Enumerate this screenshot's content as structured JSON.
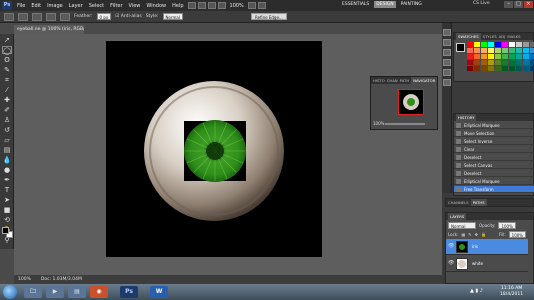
{
  "app": {
    "logo": "Ps",
    "menu": [
      "File",
      "Edit",
      "Image",
      "Layer",
      "Select",
      "Filter",
      "View",
      "Window",
      "Help"
    ],
    "zoom_display": "100%",
    "workspaces": [
      "ESSENTIALS",
      "DESIGN",
      "PAINTING"
    ],
    "active_workspace": "DESIGN",
    "cs_live": "CS Live"
  },
  "options_bar": {
    "feather_label": "Feather:",
    "feather_value": "0 px",
    "antialias_label": "Anti-alias",
    "style_label": "Style:",
    "style_value": "Normal",
    "refine_edge_label": "Refine Edge..."
  },
  "document": {
    "tab_title": "eyeball.ne @ 100% (iris, RGB/8)",
    "status_zoom": "100%",
    "status_doc": "Doc: 1.03M/3.04M"
  },
  "swatches_panel": {
    "tabs": [
      "SWATCHES",
      "STYLES",
      "ADJ",
      "MASKS"
    ],
    "colors": [
      "#ff0000",
      "#ffff00",
      "#00ff00",
      "#00ffff",
      "#0000ff",
      "#ff00ff",
      "#ffffff",
      "#cccccc",
      "#999999",
      "#666666",
      "#000000",
      "#f26c4f",
      "#f68e55",
      "#fbaf5c",
      "#fff467",
      "#acd372",
      "#7cc576",
      "#3bb878",
      "#1abbb4",
      "#00bff3",
      "#438ccb",
      "#5574b9",
      "#ed1c24",
      "#f26522",
      "#f7941d",
      "#fff200",
      "#8dc73f",
      "#39b54a",
      "#00a651",
      "#00a99d",
      "#00aeef",
      "#0072bc",
      "#0054a6",
      "#9e0b0f",
      "#a0410d",
      "#a36209",
      "#aba000",
      "#598527",
      "#1a7b30",
      "#007236",
      "#00746b",
      "#0076a3",
      "#004b80",
      "#003471",
      "#790000",
      "#7b2e00",
      "#7d4900",
      "#827b00",
      "#406618",
      "#005e20",
      "#005826",
      "#005952",
      "#005b7f",
      "#003663",
      "#002157"
    ]
  },
  "navigator": {
    "tabs": [
      "HISTO",
      "CHAN",
      "PATH",
      "NAVIGATOR"
    ],
    "active_tab": "NAVIGATOR",
    "zoom": "100%"
  },
  "history": {
    "tab": "HISTORY",
    "items": [
      "Elliptical Marquee",
      "Move Selection",
      "Select Inverse",
      "Clear",
      "Deselect",
      "Select Canvas",
      "Deselect",
      "Elliptical Marquee",
      "Free Transform"
    ],
    "active_index": 8
  },
  "channels_tabs": [
    "CHANNELS",
    "PATHS"
  ],
  "layers": {
    "tab": "LAYERS",
    "blend_mode": "Normal",
    "opacity_label": "Opacity:",
    "opacity_value": "100%",
    "lock_label": "Lock:",
    "fill_label": "Fill:",
    "fill_value": "100%",
    "items": [
      {
        "name": "iris",
        "active": true
      },
      {
        "name": "white",
        "active": false
      }
    ]
  },
  "taskbar": {
    "time": "11:16 AM",
    "date": "18/4/2011",
    "apps": [
      "Ps",
      "W"
    ]
  },
  "colors": {
    "active_blue": "#3d7bd6",
    "iris_green": "#2f8f1a"
  }
}
